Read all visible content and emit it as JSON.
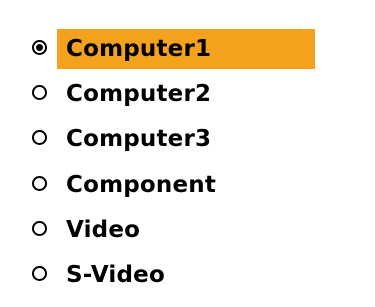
{
  "input_menu": {
    "selected_index": 0,
    "highlight_color": "#f4a21d",
    "options": [
      {
        "label": "Computer1",
        "selected": true
      },
      {
        "label": "Computer2",
        "selected": false
      },
      {
        "label": "Computer3",
        "selected": false
      },
      {
        "label": "Component",
        "selected": false
      },
      {
        "label": "Video",
        "selected": false
      },
      {
        "label": "S-Video",
        "selected": false
      }
    ]
  }
}
